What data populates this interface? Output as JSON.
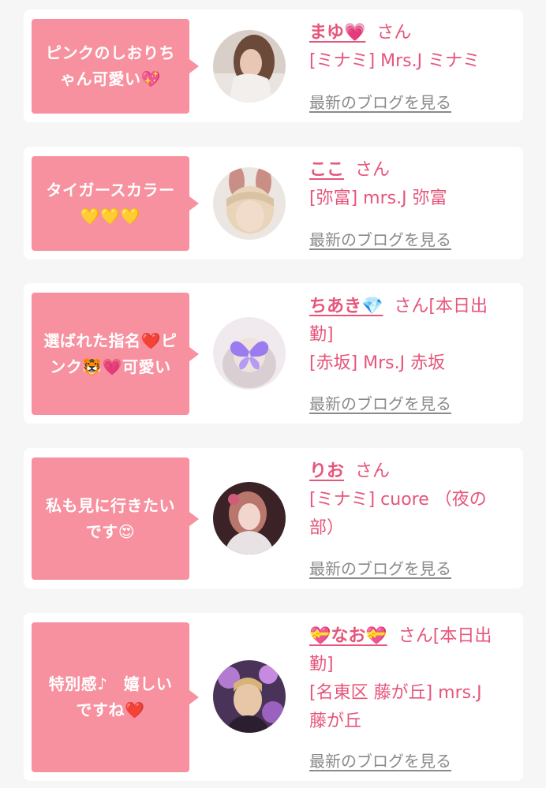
{
  "colors": {
    "bubble": "#f7919f",
    "accent": "#e6557a",
    "link_gray": "#8a8a8a",
    "card_bg": "#ffffff",
    "page_bg": "#f6f6f6"
  },
  "blog_link_label": "最新のブログを見る",
  "entries": [
    {
      "comment_line1": "ピンクのしおりち",
      "comment_line2": "ゃん可愛い💖",
      "name": "まゆ💗",
      "honorific": "さん",
      "shop": "[ミナミ] Mrs.J ミナミ",
      "avatar_icon": "woman-portrait-icon"
    },
    {
      "comment_line1": "タイガースカラー",
      "comment_line2": "💛💛💛",
      "name": "ここ",
      "honorific": "さん",
      "shop": "[弥富] mrs.J 弥富",
      "avatar_icon": "bunny-ears-portrait-icon"
    },
    {
      "comment_line1": "選ばれた指名❤️ピ",
      "comment_line2": "ンク🐯💗可愛い",
      "name": "ちあき💎",
      "honorific": "さん[本日出",
      "honorific_line2": "勤]",
      "shop": "[赤坂] Mrs.J 赤坂",
      "avatar_icon": "butterfly-portrait-icon"
    },
    {
      "comment_line1": "私も見に行きたい",
      "comment_line2": "です😍",
      "name": "りお",
      "honorific": "さん",
      "shop": "[ミナミ] cuore （夜の",
      "shop_line2": "部）",
      "avatar_icon": "woman-portrait-icon"
    },
    {
      "comment_line1": "特別感♪　嬉しい",
      "comment_line2": "ですね❤️",
      "name": "💝なお💝",
      "honorific": "さん[本日出",
      "honorific_line2": "勤]",
      "shop": "[名東区 藤が丘] mrs.J",
      "shop_line2": "藤が丘",
      "avatar_icon": "flower-portrait-icon"
    }
  ]
}
